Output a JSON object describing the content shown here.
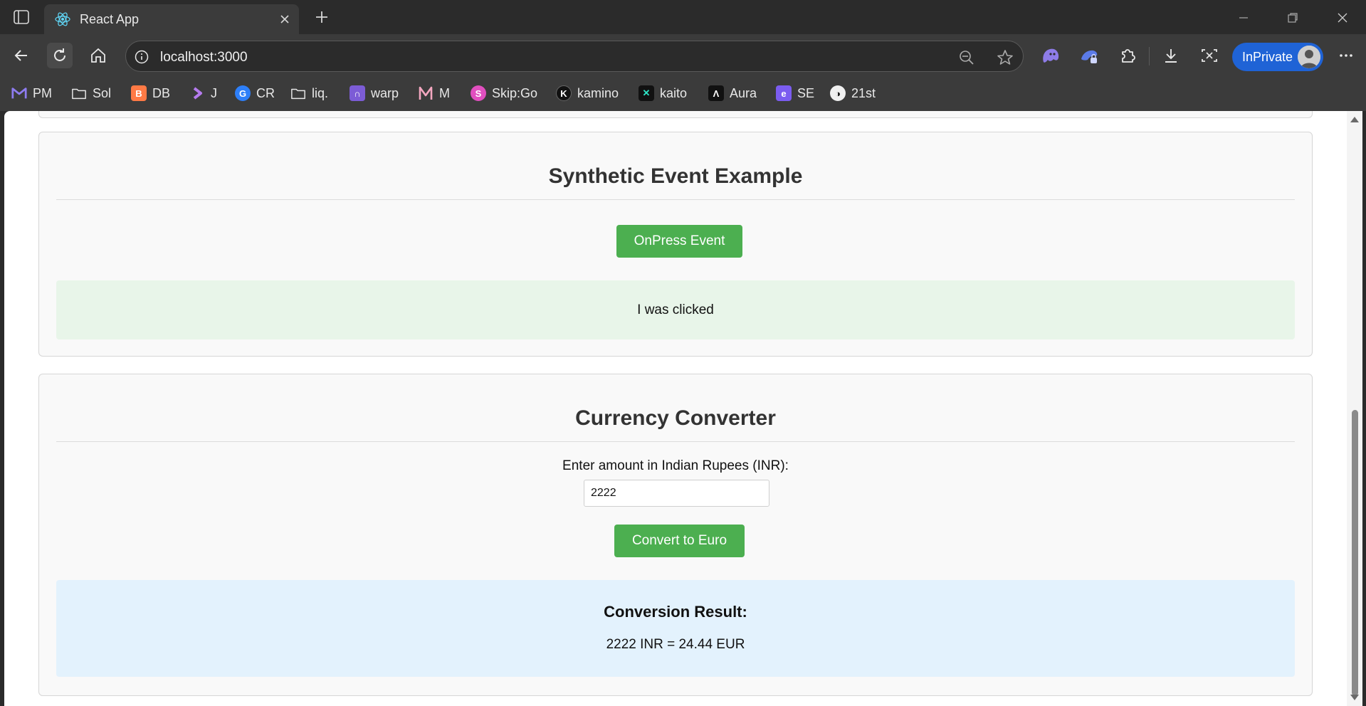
{
  "browser": {
    "tab_title": "React App",
    "url": "localhost:3000",
    "inprivate_label": "InPrivate",
    "bookmarks": [
      {
        "label": "PM",
        "icon": "gmail-icon",
        "color": "#7b68ee"
      },
      {
        "label": "Sol",
        "icon": "folder-icon",
        "color": "#e8e8e8"
      },
      {
        "label": "DB",
        "icon": "db-icon",
        "color": "#ff7a45"
      },
      {
        "label": "J",
        "icon": "jira-icon",
        "color": "#b57bee"
      },
      {
        "label": "CR",
        "icon": "cr-icon",
        "color": "#2d7ff9"
      },
      {
        "label": "liq.",
        "icon": "folder-icon",
        "color": "#e8e8e8"
      },
      {
        "label": "warp",
        "icon": "warp-icon",
        "color": "#7c5cd6"
      },
      {
        "label": "M",
        "icon": "m-icon",
        "color": "#f4a7c0"
      },
      {
        "label": "Skip:Go",
        "icon": "skipgo-icon",
        "color": "#e14fbf"
      },
      {
        "label": "kamino",
        "icon": "kamino-icon",
        "color": "#111111"
      },
      {
        "label": "kaito",
        "icon": "kaito-icon",
        "color": "#111111"
      },
      {
        "label": "Aura",
        "icon": "aura-icon",
        "color": "#111111"
      },
      {
        "label": "SE",
        "icon": "se-icon",
        "color": "#7b5cf0"
      },
      {
        "label": "21st",
        "icon": "21st-icon",
        "color": "#111111"
      }
    ]
  },
  "synthetic": {
    "heading": "Synthetic Event Example",
    "button_label": "OnPress Event",
    "message": "I was clicked"
  },
  "converter": {
    "heading": "Currency Converter",
    "input_label": "Enter amount in Indian Rupees (INR):",
    "input_value": "2222",
    "button_label": "Convert to Euro",
    "result_title": "Conversion Result:",
    "result_text": "2222 INR = 24.44 EUR"
  },
  "colors": {
    "accent_green": "#4caf50",
    "message_bg": "#e8f5e9",
    "result_bg": "#e3f2fd",
    "inprivate_blue": "#1f63d6"
  }
}
